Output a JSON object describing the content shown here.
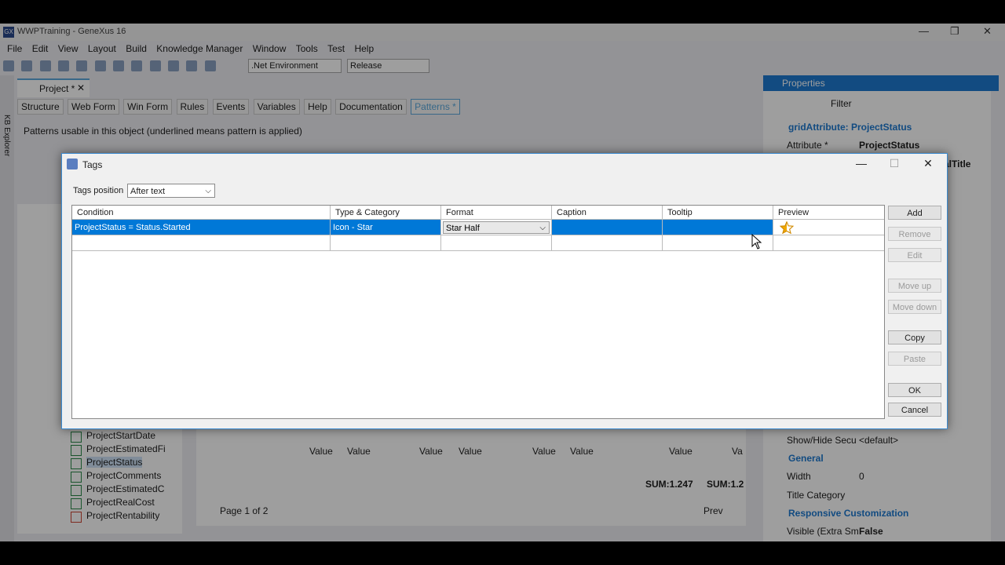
{
  "app": {
    "window_title": "WWPTraining - GeneXus 16",
    "menu": [
      "File",
      "Edit",
      "View",
      "Layout",
      "Build",
      "Knowledge Manager",
      "Window",
      "Tools",
      "Test",
      "Help"
    ],
    "environment": ".Net Environment",
    "configuration": "Release",
    "doc_tab": "Project *",
    "subtabs": [
      "Structure",
      "Web Form",
      "Win Form",
      "Rules",
      "Events",
      "Variables",
      "Help",
      "Documentation",
      "Patterns *"
    ],
    "patterns_hint": "Patterns usable in this object (underlined means pattern is applied)",
    "kb_explorer_label": "KB Explorer",
    "tree_items": [
      "ProjectStartDate",
      "ProjectEstimatedFi",
      "ProjectStatus",
      "ProjectComments",
      "ProjectEstimatedC",
      "ProjectRealCost",
      "ProjectRentability"
    ],
    "grid_preview": {
      "value_labels": [
        "Value",
        "Value",
        "Value",
        "Value",
        "Value",
        "Value",
        "Value",
        "Va"
      ],
      "sums": [
        "SUM:1.247",
        "SUM:1.2"
      ],
      "pager": "Page 1 of 2",
      "prev": "Prev"
    },
    "properties": {
      "title": "Properties",
      "filter_label": "Filter",
      "section": "gridAttribute: ProjectStatus",
      "attribute_label": "Attribute *",
      "attribute_value": "ProjectStatus",
      "partial_value": "alTitle",
      "show_hide_label": "Show/Hide Secu",
      "show_hide_value": "<default>",
      "general_cat": "General",
      "width_label": "Width",
      "width_value": "0",
      "title_category_label": "Title Category",
      "responsive_cat": "Responsive Customization",
      "visible_label": "Visible (Extra Sm",
      "visible_value": "False"
    }
  },
  "dialog": {
    "title": "Tags",
    "tags_position_label": "Tags position",
    "tags_position_value": "After text",
    "columns": [
      "Condition",
      "Type & Category",
      "Format",
      "Caption",
      "Tooltip",
      "Preview"
    ],
    "rows": [
      {
        "condition": "ProjectStatus = Status.Started",
        "type_category": "Icon - Star",
        "format": "Star Half",
        "caption": "",
        "tooltip": "",
        "preview": "star-half-icon"
      }
    ],
    "buttons": {
      "add": "Add",
      "remove": "Remove",
      "edit": "Edit",
      "move_up": "Move up",
      "move_down": "Move down",
      "copy": "Copy",
      "paste": "Paste",
      "ok": "OK",
      "cancel": "Cancel"
    },
    "colors": {
      "selection": "#0078d7",
      "star": "#f0a800",
      "accent": "#1e79d0"
    }
  }
}
